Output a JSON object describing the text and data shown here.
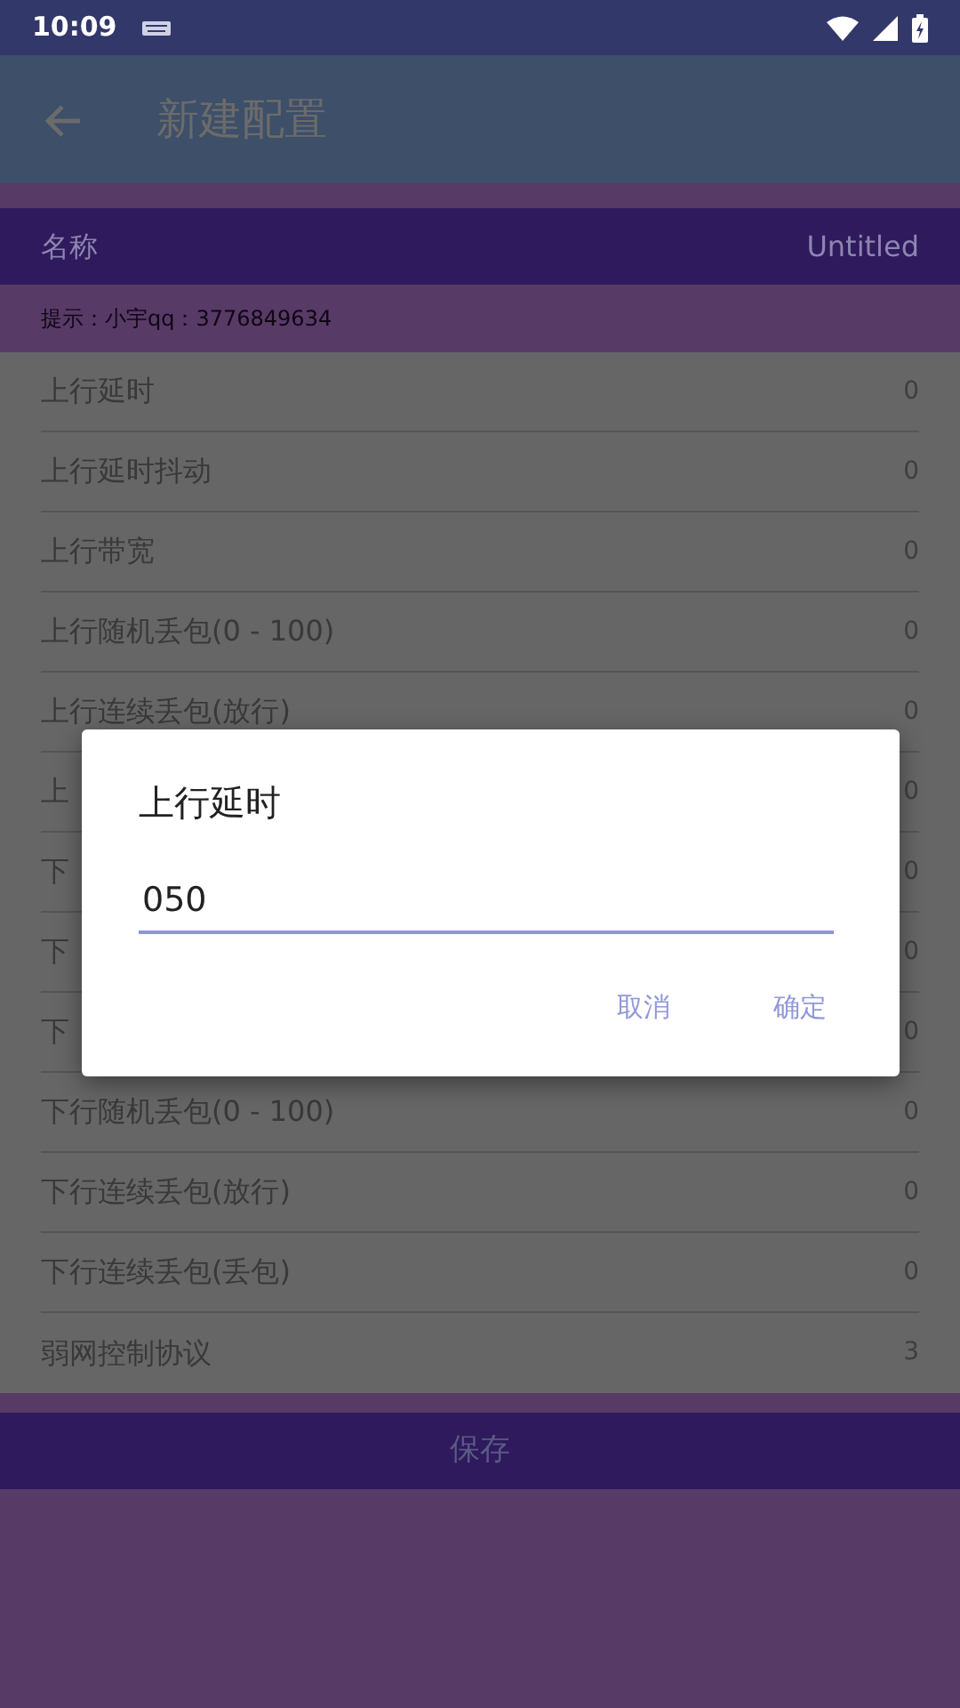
{
  "status_bar": {
    "time": "10:09"
  },
  "app_bar": {
    "title": "新建配置"
  },
  "name_row": {
    "label": "名称",
    "value": "Untitled"
  },
  "hint": "提示：小宇qq：3776849634",
  "settings": [
    {
      "label": "上行延时",
      "value": "0"
    },
    {
      "label": "上行延时抖动",
      "value": "0"
    },
    {
      "label": "上行带宽",
      "value": "0"
    },
    {
      "label": "上行随机丢包(0 - 100)",
      "value": "0"
    },
    {
      "label": "上行连续丢包(放行)",
      "value": "0"
    },
    {
      "label": "上",
      "value": "0"
    },
    {
      "label": "下",
      "value": "0"
    },
    {
      "label": "下",
      "value": "0"
    },
    {
      "label": "下",
      "value": "0"
    },
    {
      "label": "下行随机丢包(0 - 100)",
      "value": "0"
    },
    {
      "label": "下行连续丢包(放行)",
      "value": "0"
    },
    {
      "label": "下行连续丢包(丢包)",
      "value": "0"
    },
    {
      "label": "弱网控制协议",
      "value": "3"
    }
  ],
  "save_button": "保存",
  "dialog": {
    "title": "上行延时",
    "value": "050",
    "buttons": [
      "取消",
      "确定"
    ]
  }
}
